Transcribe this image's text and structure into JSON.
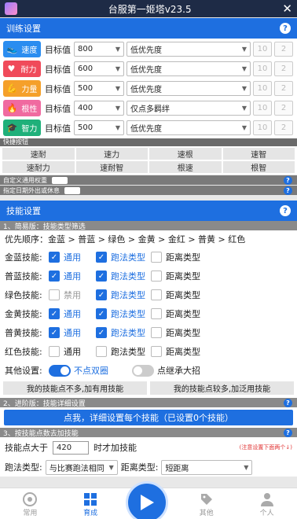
{
  "window": {
    "title": "台服第一姬塔v23.5",
    "close": "✕"
  },
  "training": {
    "title": "训练设置",
    "help": "?",
    "rows": [
      {
        "tag": "速度",
        "color": "#2a8df0",
        "icon": "👟",
        "label": "目标值",
        "target": "800",
        "priority": "低优先度",
        "a": "10",
        "b": "2"
      },
      {
        "tag": "耐力",
        "color": "#f04a5a",
        "icon": "♥",
        "label": "目标值",
        "target": "600",
        "priority": "低优先度",
        "a": "10",
        "b": "2"
      },
      {
        "tag": "力量",
        "color": "#f5a02a",
        "icon": "💪",
        "label": "目标值",
        "target": "500",
        "priority": "低优先度",
        "a": "10",
        "b": "2"
      },
      {
        "tag": "根性",
        "color": "#f06aa0",
        "icon": "🔥",
        "label": "目标值",
        "target": "400",
        "priority": "仅点多羁绊",
        "a": "10",
        "b": "2"
      },
      {
        "tag": "智力",
        "color": "#1fb07a",
        "icon": "🎓",
        "label": "目标值",
        "target": "500",
        "priority": "低优先度",
        "a": "10",
        "b": "2"
      }
    ]
  },
  "quick": {
    "title": "快捷按钮",
    "buttons": [
      "速耐",
      "速力",
      "速根",
      "速智",
      "速耐力",
      "速耐智",
      "根速",
      "根智"
    ]
  },
  "custom_weight": "自定义通用权重",
  "date_rest": "指定日期外出或休息",
  "skills": {
    "title": "技能设置",
    "help": "?",
    "basic_title": "1、简易版：技能类型筛选",
    "order_label": "优先顺序：",
    "order": "金蓝 > 普蓝 > 绿色 > 金黄 > 金红 > 普黄 > 红色",
    "rows": [
      {
        "name": "金蓝技能:",
        "o1": "通用",
        "o2": "跑法类型",
        "o3": "距离类型"
      },
      {
        "name": "普蓝技能:",
        "o1": "通用",
        "o2": "跑法类型",
        "o3": "距离类型"
      },
      {
        "name": "绿色技能:",
        "o1": "禁用",
        "o2": "跑法类型",
        "o3": "距离类型"
      },
      {
        "name": "金黄技能:",
        "o1": "通用",
        "o2": "跑法类型",
        "o3": "距离类型"
      },
      {
        "name": "普黄技能:",
        "o1": "通用",
        "o2": "跑法类型",
        "o3": "距离类型"
      },
      {
        "name": "红色技能:",
        "o1": "通用",
        "o2": "跑法类型",
        "o3": "距离类型"
      }
    ],
    "other_label": "其他设置:",
    "sw1": "不点双圈",
    "sw2": "点继承大招",
    "btn_few": "我的技能点不多,加有用技能",
    "btn_many": "我的技能点较多,加泛用技能",
    "adv_title": "2、进阶版：技能详细设置",
    "adv_btn": "点我，详细设置每个技能（已设置0个技能）",
    "order2_title": "3、按技能点数去加技能",
    "points_label": "技能点大于",
    "points_value": "420",
    "points_suffix": "时才加技能",
    "note": "(注意设置下面两个↓)",
    "run_label": "跑法类型:",
    "run_value": "与比赛跑法相同",
    "dist_label": "距离类型:",
    "dist_value": "短距离"
  },
  "nav": {
    "tabs": [
      "常用",
      "育成",
      "",
      "其他",
      "个人"
    ]
  }
}
